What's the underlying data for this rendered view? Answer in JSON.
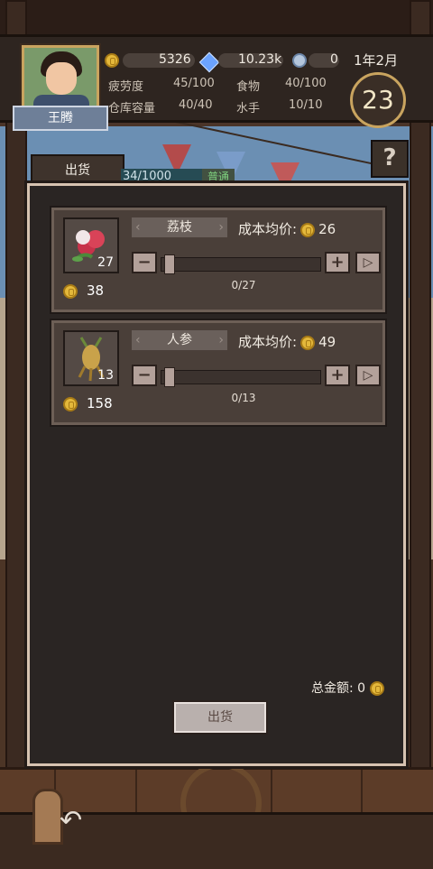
{
  "player": {
    "name": "王腾"
  },
  "resources": {
    "coins": "5326",
    "gems": "10.23k",
    "sailors_count": "0",
    "date": "1年2月",
    "day": "23"
  },
  "stats": [
    {
      "label": "疲劳度",
      "value": "45/100"
    },
    {
      "label": "食物",
      "value": "40/100"
    },
    {
      "label": "仓库容量",
      "value": "40/40"
    },
    {
      "label": "水手",
      "value": "10/10"
    }
  ],
  "help_label": "?",
  "tab_label": "出货",
  "xp_text": "34/1000",
  "rank_text": "普通",
  "items": [
    {
      "name": "荔枝",
      "cost_label": "成本均价:",
      "cost": "26",
      "stock": "27",
      "price": "38",
      "slider_text": "0/27",
      "slider_fraction": 0,
      "icon": "lychee-icon"
    },
    {
      "name": "人参",
      "cost_label": "成本均价:",
      "cost": "49",
      "stock": "13",
      "price": "158",
      "slider_text": "0/13",
      "slider_fraction": 0,
      "icon": "ginseng-icon"
    }
  ],
  "total_label": "总金额:",
  "total_value": "0",
  "sell_button": "出货",
  "colors": {
    "accent": "#c9a45f",
    "panel": "#2a2523",
    "card": "#4a3f39"
  }
}
